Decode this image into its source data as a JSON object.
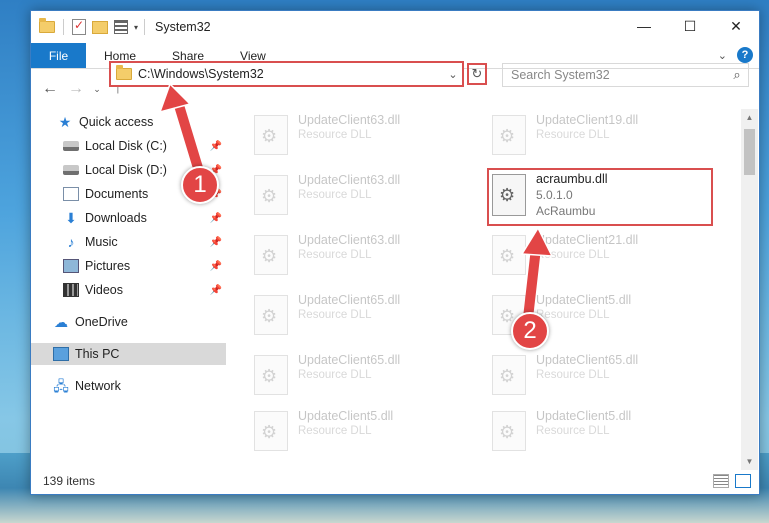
{
  "window": {
    "title": "System32",
    "controls": {
      "minimize": "—",
      "maximize": "☐",
      "close": "✕"
    }
  },
  "ribbon": {
    "tabs": [
      "File",
      "Home",
      "Share",
      "View"
    ]
  },
  "address": {
    "path": "C:\\Windows\\System32",
    "search_placeholder": "Search System32"
  },
  "nav": {
    "items": [
      {
        "label": "Quick access",
        "icon": "star-icon"
      },
      {
        "label": "Local Disk (C:)",
        "icon": "drive-icon",
        "pinned": true
      },
      {
        "label": "Local Disk (D:)",
        "icon": "drive-icon",
        "pinned": true
      },
      {
        "label": "Documents",
        "icon": "documents-icon",
        "pinned": true
      },
      {
        "label": "Downloads",
        "icon": "download-icon",
        "pinned": true
      },
      {
        "label": "Music",
        "icon": "music-icon",
        "pinned": true
      },
      {
        "label": "Pictures",
        "icon": "pictures-icon",
        "pinned": true
      },
      {
        "label": "Videos",
        "icon": "videos-icon",
        "pinned": true
      },
      {
        "label": "OneDrive",
        "icon": "cloud-icon"
      },
      {
        "label": "This PC",
        "icon": "computer-icon",
        "selected": true
      },
      {
        "label": "Network",
        "icon": "network-icon"
      }
    ]
  },
  "files": {
    "left": [
      {
        "name": "UpdateClient63.dll",
        "type": "Resource DLL"
      },
      {
        "name": "UpdateClient63.dll",
        "type": "Resource DLL"
      },
      {
        "name": "UpdateClient63.dll",
        "type": "Resource DLL"
      },
      {
        "name": "UpdateClient65.dll",
        "type": "Resource DLL"
      },
      {
        "name": "UpdateClient65.dll",
        "type": "Resource DLL"
      },
      {
        "name": "UpdateClient5.dll",
        "type": "Resource DLL"
      }
    ],
    "right": [
      {
        "name": "UpdateClient19.dll",
        "type": "Resource DLL"
      },
      {
        "name": "UpdateClient21.dll",
        "type": "Resource DLL"
      },
      {
        "name": "UpdateClient5.dll",
        "type": "Resource DLL"
      },
      {
        "name": "UpdateClient65.dll",
        "type": "Resource DLL"
      },
      {
        "name": "UpdateClient5.dll",
        "type": "Resource DLL"
      }
    ],
    "highlighted": {
      "name": "acraumbu.dll",
      "version": "5.0.1.0",
      "description": "AcRaumbu"
    }
  },
  "status": {
    "item_count": "139 items"
  },
  "annotations": {
    "marker1": "1",
    "marker2": "2",
    "color": "#e24545"
  }
}
